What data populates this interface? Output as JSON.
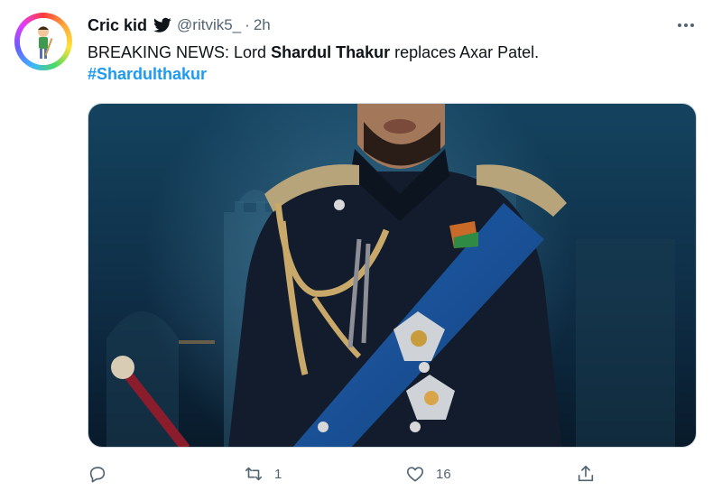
{
  "tweet": {
    "author_name": "Cric kid",
    "author_handle": "@ritvik5_",
    "separator": "·",
    "time": "2h",
    "text": {
      "prefix": "BREAKING NEWS: Lord ",
      "bold": "Shardul Thakur",
      "suffix": " replaces Axar Patel."
    },
    "hashtag": "#Shardulthakur",
    "media_description_icon": "photo"
  },
  "actions": {
    "reply_count": "",
    "retweet_count": "1",
    "like_count": "16",
    "share_count": ""
  },
  "colors": {
    "text": "#0f1419",
    "secondary": "#536471",
    "link": "#1d9bf0",
    "border": "#cfd9de"
  },
  "icons": [
    "bird-icon",
    "more-icon",
    "reply-icon",
    "retweet-icon",
    "like-icon",
    "share-icon"
  ]
}
